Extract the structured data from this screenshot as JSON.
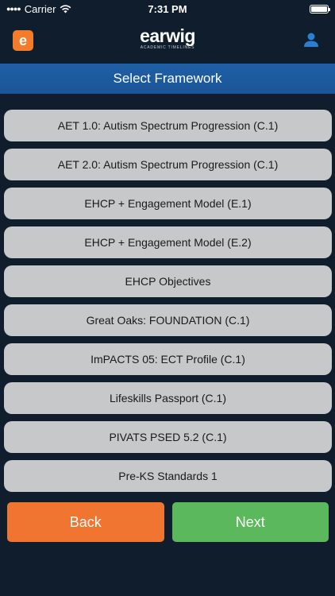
{
  "status_bar": {
    "carrier": "Carrier",
    "time": "7:31 PM"
  },
  "header": {
    "app_icon_letter": "e",
    "logo_text": "earwig",
    "logo_subtitle": "ACADEMIC TIMELINES",
    "icons": {
      "app": "earwig-app-icon",
      "profile": "user-profile-icon"
    }
  },
  "title": "Select Framework",
  "frameworks": [
    "AET 1.0: Autism Spectrum Progression (C.1)",
    "AET 2.0: Autism Spectrum Progression (C.1)",
    "EHCP + Engagement Model (E.1)",
    "EHCP + Engagement Model (E.2)",
    "EHCP Objectives",
    "Great Oaks: FOUNDATION (C.1)",
    "ImPACTS 05: ECT Profile (C.1)",
    "Lifeskills Passport (C.1)",
    "PIVATS PSED 5.2 (C.1)",
    "Pre-KS Standards 1"
  ],
  "buttons": {
    "back": "Back",
    "next": "Next"
  },
  "colors": {
    "background": "#0f1d2c",
    "title_bar": "#1a5597",
    "list_item": "#c6c8ca",
    "back": "#f07530",
    "next": "#5cb85c",
    "brand_orange": "#f47b2a",
    "profile_icon": "#2a7fd4"
  }
}
